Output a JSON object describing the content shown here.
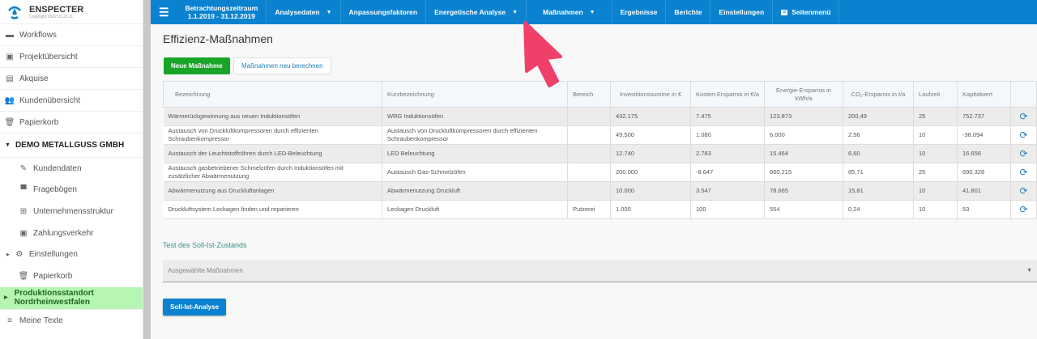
{
  "app": {
    "name": "ENSPECTER",
    "copyright": "Copyright 2022 v1.23.11"
  },
  "sidebar": {
    "items": [
      {
        "label": "Workflows",
        "icon": "briefcase-icon"
      },
      {
        "label": "Projektübersicht",
        "icon": "calendar-icon"
      },
      {
        "label": "Akquise",
        "icon": "printer-icon"
      },
      {
        "label": "Kundenübersicht",
        "icon": "people-icon"
      },
      {
        "label": "Papierkorb",
        "icon": "trash-icon"
      }
    ],
    "group": "DEMO METALLGUSS GMBH",
    "sub": [
      {
        "label": "Kundendaten",
        "icon": "pencil-icon"
      },
      {
        "label": "Fragebögen",
        "icon": "comment-icon"
      },
      {
        "label": "Unternehmensstruktur",
        "icon": "tree-icon"
      },
      {
        "label": "Zahlungsverkehr",
        "icon": "square-icon"
      },
      {
        "label": "Einstellungen",
        "icon": "gear-icon"
      },
      {
        "label": "Papierkorb",
        "icon": "trash-icon"
      }
    ],
    "highlight": "Produktionsstandort Nordrheinwestfalen",
    "footer": "Meine Texte"
  },
  "topbar": {
    "period_label": "Betrachtungszeitraum",
    "period": "1.1.2019 - 31.12.2019",
    "nav": [
      "Analysedaten",
      "Anpassungsfaktoren",
      "Energetische Analyse",
      "Maßnahmen",
      "Ergebnisse",
      "Berichte",
      "Einstellungen",
      "Seitenmenü"
    ]
  },
  "main": {
    "title": "Effizienz-Maßnahmen",
    "new_button": "Neue Maßnahme",
    "recalc_button": "Maßnahmen neu berechnen",
    "columns": [
      "Bezeichnung",
      "Kurzbezeichnung",
      "Bereich",
      "Investitionssumme in €",
      "Kosten-Ersparnis in €/a",
      "Energie-Ersparnis in kWh/a",
      "CO₂-Ersparnis in t/a",
      "Laufzeit",
      "Kapitalwert"
    ],
    "rows": [
      [
        "Wärmerückgewinnung aus neuen Induktionsöfen",
        "WRG Induktionsöfen",
        "",
        "432.175",
        "7.475",
        "123.873",
        "200,49",
        "25",
        "752.737"
      ],
      [
        "Austausch von Druckluftkompressoren durch effizienten Schraubenkompressor",
        "Austausch von Druckluftkompressoren durch effizienten Schraubenkompressor",
        "",
        "49.500",
        "1.080",
        "6.000",
        "2,56",
        "10",
        "-38.094"
      ],
      [
        "Austausch der Leuchtstoffröhren durch LED-Beleuchtung",
        "LED Beleuchtung",
        "",
        "12.740",
        "2.783",
        "15.464",
        "6,60",
        "10",
        "16.656"
      ],
      [
        "Austausch gasbetriebener Schmelzöfen durch Induktionsöfen mit zusätzlicher Abwärmenutzung",
        "Austausch Gas-Schmelzöfen",
        "",
        "200.000",
        "-8.647",
        "660.215",
        "85,71",
        "25",
        "690.328"
      ],
      [
        "Abwärmenutzung aus Druckluftanlagen",
        "Abwärmenutzung Druckluft",
        "",
        "10.000",
        "3.547",
        "78.665",
        "15,81",
        "10",
        "41.801"
      ],
      [
        "Druckluftsystem Leckagen finden und reparieren",
        "Leckagen Druckluft",
        "Putzerei",
        "1.000",
        "100",
        "554",
        "0,24",
        "10",
        "53"
      ]
    ],
    "soll_title": "Test des Soll-Ist-Zustands",
    "select_placeholder": "Ausgewählte Maßnahmen",
    "soll_button": "Soll-Ist-Analyse"
  },
  "colors": {
    "primary": "#0a82cf",
    "success": "#1aa52a",
    "highlight": "#b7f5b3",
    "cursor": "#f0406a"
  }
}
